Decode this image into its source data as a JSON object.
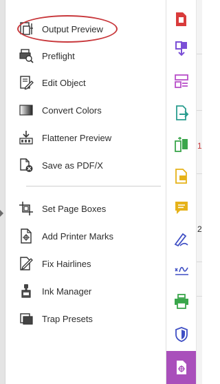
{
  "tools": {
    "group1": [
      {
        "label": "Output Preview",
        "icon": "output-preview-icon"
      },
      {
        "label": "Preflight",
        "icon": "preflight-icon"
      },
      {
        "label": "Edit Object",
        "icon": "edit-object-icon"
      },
      {
        "label": "Convert Colors",
        "icon": "convert-colors-icon"
      },
      {
        "label": "Flattener Preview",
        "icon": "flattener-preview-icon"
      },
      {
        "label": "Save as PDF/X",
        "icon": "save-as-pdfx-icon"
      }
    ],
    "group2": [
      {
        "label": "Set Page Boxes",
        "icon": "set-page-boxes-icon"
      },
      {
        "label": "Add Printer Marks",
        "icon": "add-printer-marks-icon"
      },
      {
        "label": "Fix Hairlines",
        "icon": "fix-hairlines-icon"
      },
      {
        "label": "Ink Manager",
        "icon": "ink-manager-icon"
      },
      {
        "label": "Trap Presets",
        "icon": "trap-presets-icon"
      }
    ]
  },
  "highlight": {
    "target": "Output Preview",
    "color": "#c8373b"
  },
  "rail": {
    "icons": [
      {
        "name": "create-pdf-icon",
        "color": "#d93b3b"
      },
      {
        "name": "combine-files-icon",
        "color": "#7b4fd6"
      },
      {
        "name": "organize-pages-icon",
        "color": "#b84fc9"
      },
      {
        "name": "export-pdf-icon",
        "color": "#2a9d8f"
      },
      {
        "name": "compare-files-icon",
        "color": "#3aa64b"
      },
      {
        "name": "comment-icon",
        "color": "#e6b219"
      },
      {
        "name": "sticky-note-icon",
        "color": "#e6b219"
      },
      {
        "name": "fill-and-sign-icon",
        "color": "#3f4fc4"
      },
      {
        "name": "certificates-icon",
        "color": "#3f4fc4"
      },
      {
        "name": "print-production-icon",
        "color": "#3aa64b"
      },
      {
        "name": "protect-icon",
        "color": "#3f4fc4"
      },
      {
        "name": "print-production-active-icon",
        "color": "#ffffff"
      }
    ],
    "active_bg": "#a94fbb"
  },
  "edge_fragments": [
    {
      "text": "1",
      "color": "#c8373b"
    },
    {
      "text": "2",
      "color": "#2c2c2c"
    }
  ]
}
